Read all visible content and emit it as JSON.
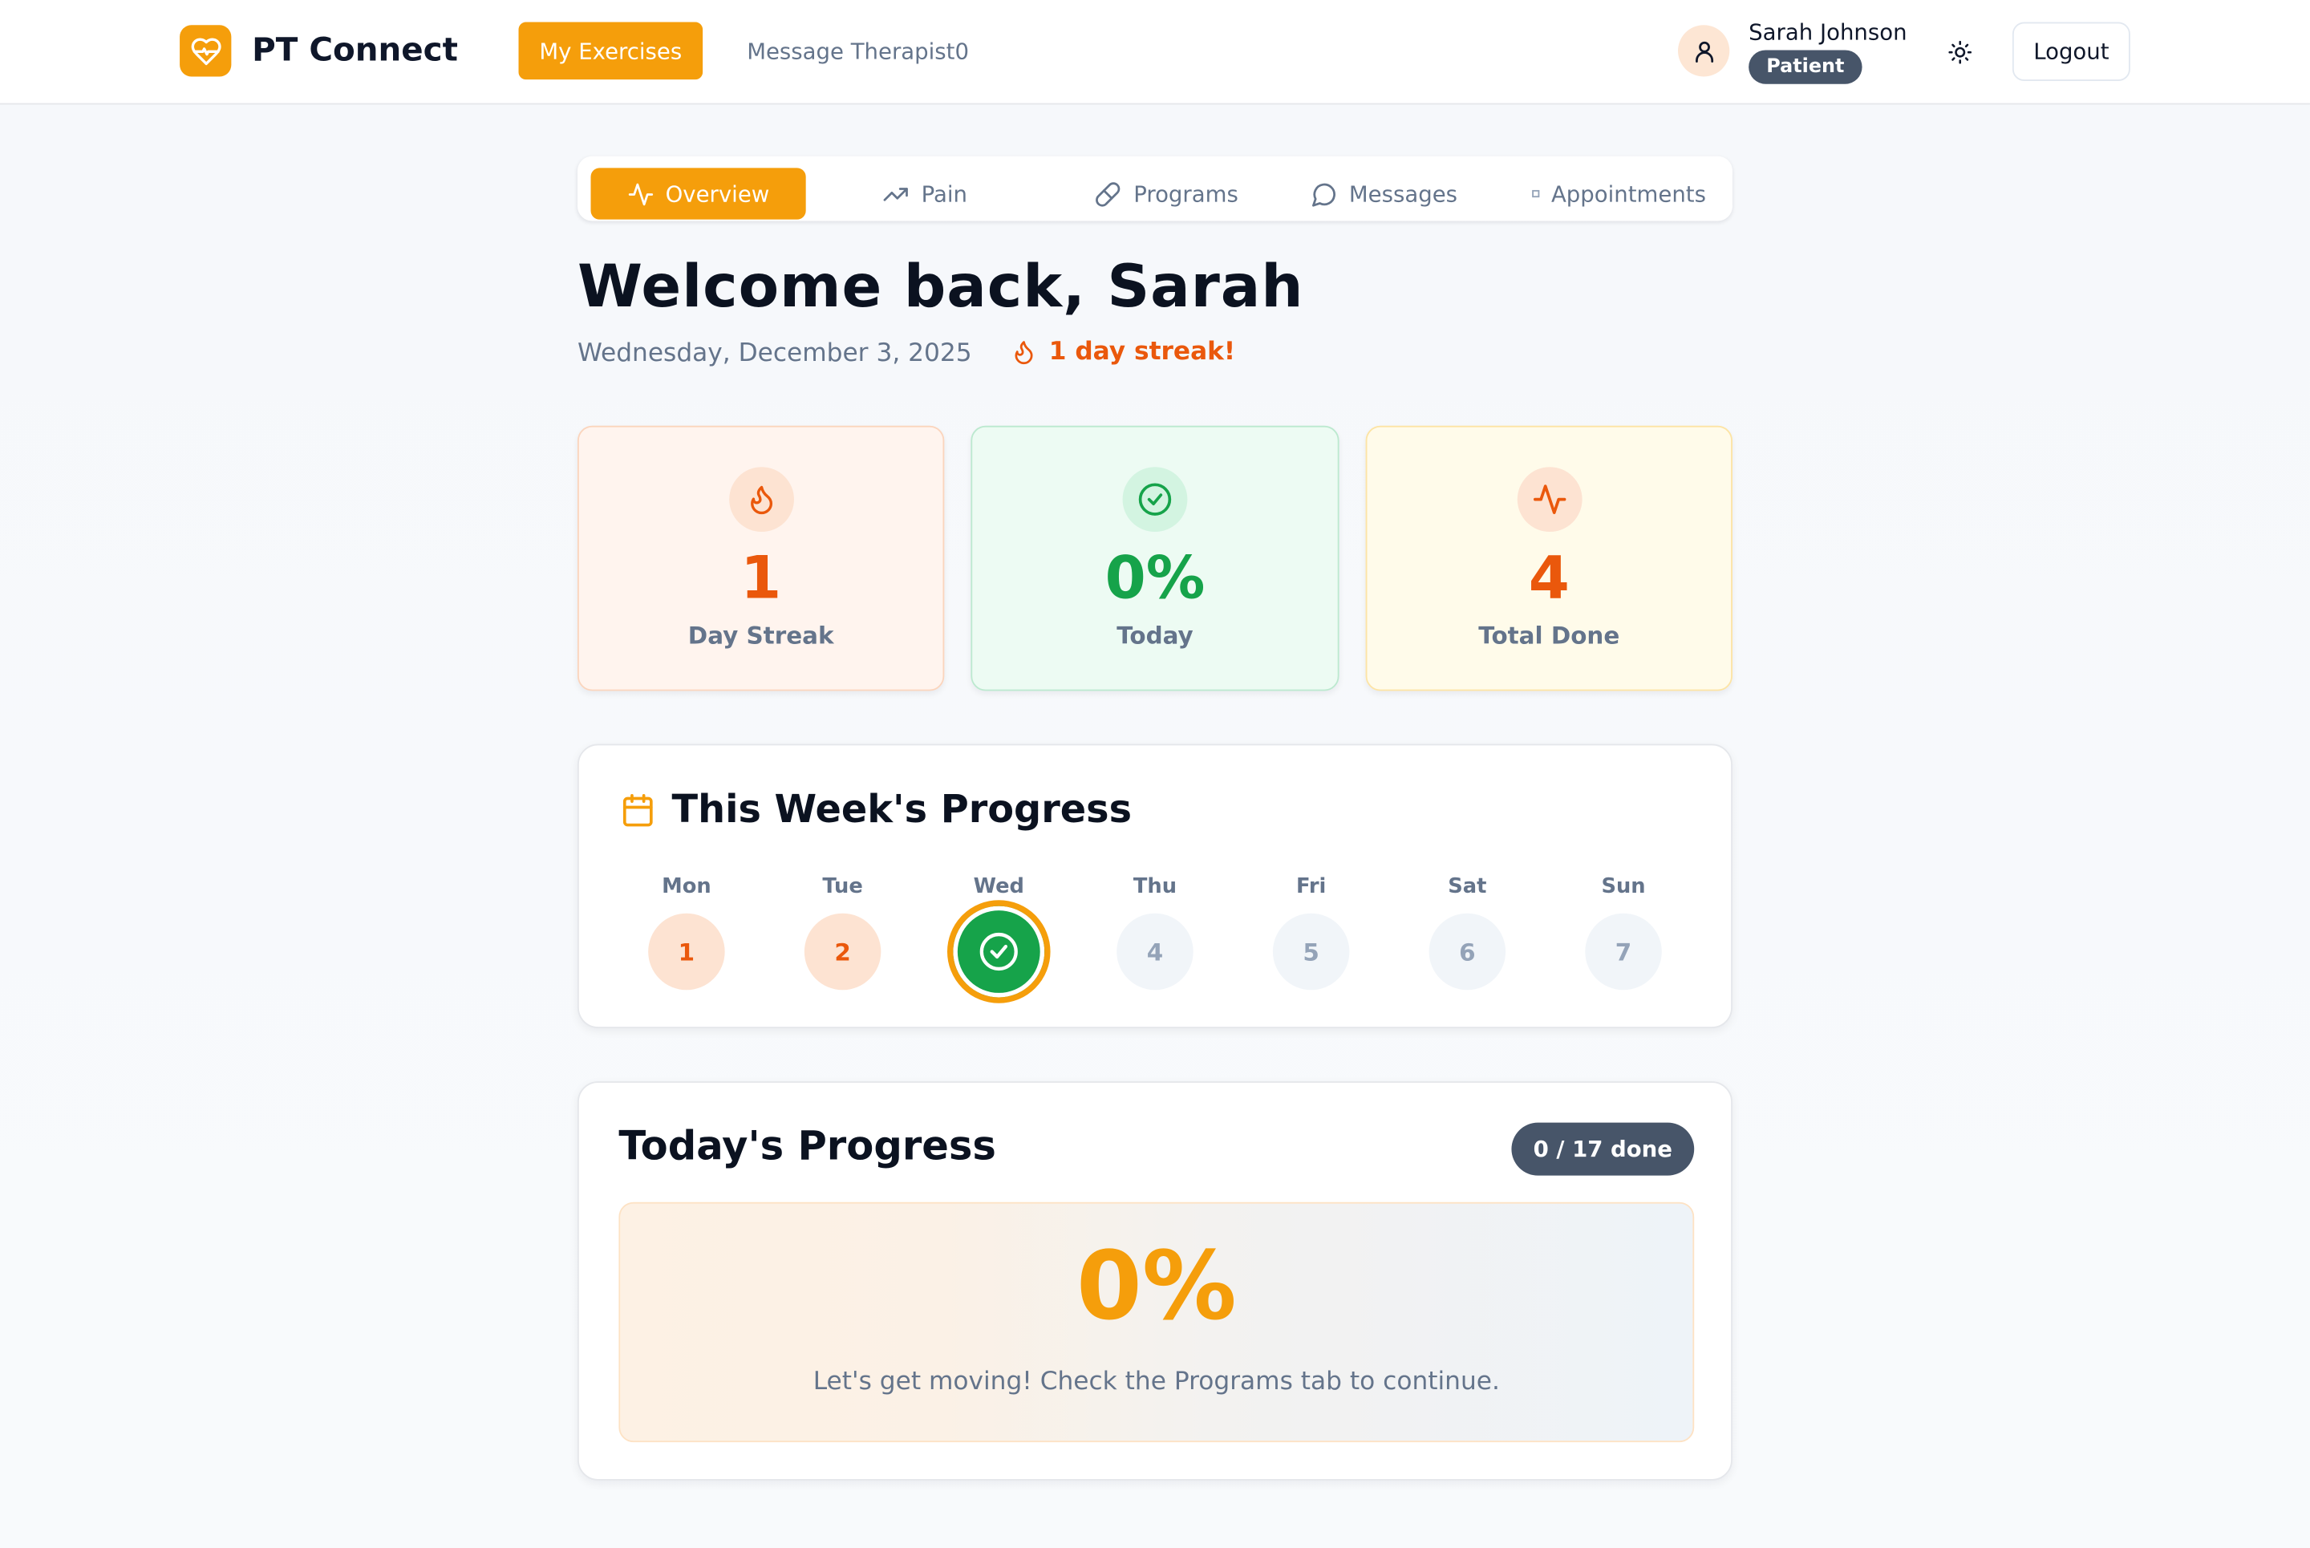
{
  "app": {
    "name": "PT Connect"
  },
  "nav": {
    "exercises_label": "My Exercises",
    "message_label": "Message Therapist0"
  },
  "user": {
    "name": "Sarah Johnson",
    "role": "Patient"
  },
  "header": {
    "logout_label": "Logout"
  },
  "tabs": [
    {
      "label": "Overview",
      "icon": "activity-icon",
      "active": true
    },
    {
      "label": "Pain",
      "icon": "trending-up-icon",
      "active": false
    },
    {
      "label": "Programs",
      "icon": "pill-icon",
      "active": false
    },
    {
      "label": "Messages",
      "icon": "message-circle-icon",
      "active": false
    },
    {
      "label": "Appointments",
      "icon": "square-icon",
      "active": false
    }
  ],
  "greeting": {
    "title": "Welcome back, Sarah",
    "date": "Wednesday, December 3, 2025",
    "streak": "1 day streak!"
  },
  "stats": [
    {
      "value": "1",
      "label": "Day Streak",
      "icon": "flame-icon"
    },
    {
      "value": "0%",
      "label": "Today",
      "icon": "check-circle-icon"
    },
    {
      "value": "4",
      "label": "Total Done",
      "icon": "activity-icon"
    }
  ],
  "week": {
    "title": "This Week's Progress",
    "days": [
      {
        "label": "Mon",
        "number": "1",
        "state": "past"
      },
      {
        "label": "Tue",
        "number": "2",
        "state": "past"
      },
      {
        "label": "Wed",
        "number": "",
        "state": "today"
      },
      {
        "label": "Thu",
        "number": "4",
        "state": "future"
      },
      {
        "label": "Fri",
        "number": "5",
        "state": "future"
      },
      {
        "label": "Sat",
        "number": "6",
        "state": "future"
      },
      {
        "label": "Sun",
        "number": "7",
        "state": "future"
      }
    ]
  },
  "today": {
    "title": "Today's Progress",
    "done_badge": "0 / 17 done",
    "percent": "0%",
    "message": "Let's get moving! Check the Programs tab to continue."
  },
  "colors": {
    "accent": "#f59e0b",
    "orange": "#ea580c",
    "green": "#16a34a",
    "slate": "#475569"
  }
}
